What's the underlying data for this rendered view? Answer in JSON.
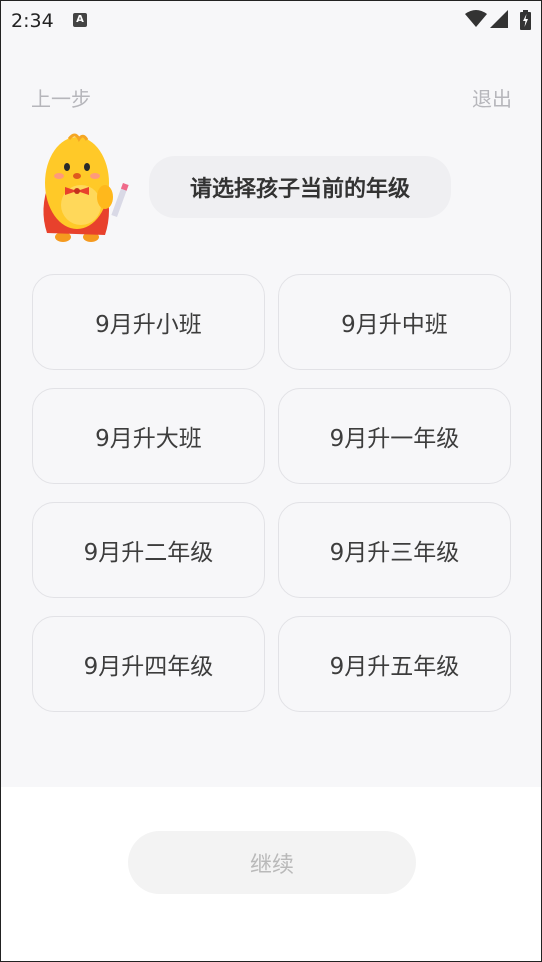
{
  "status_bar": {
    "time": "2:34",
    "notification_icon_letter": "A",
    "icons": [
      "a-notification-icon",
      "wifi-icon",
      "signal-icon",
      "battery-charging-icon"
    ]
  },
  "nav": {
    "prev_label": "上一步",
    "exit_label": "退出"
  },
  "prompt": {
    "text": "请选择孩子当前的年级"
  },
  "grades": [
    "9月升小班",
    "9月升中班",
    "9月升大班",
    "9月升一年级",
    "9月升二年级",
    "9月升三年级",
    "9月升四年级",
    "9月升五年级"
  ],
  "continue": {
    "label": "继续"
  },
  "colors": {
    "page_bg": "#f7f7f9",
    "option_border": "#e2e2e6",
    "muted_text": "#b6b6bb",
    "option_text": "#3d3d3d",
    "mascot_yellow": "#ffc928",
    "mascot_red": "#e8412c"
  }
}
